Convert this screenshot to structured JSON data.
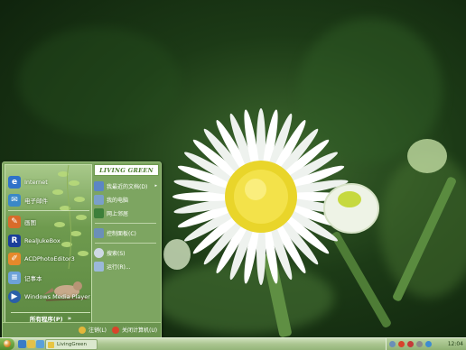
{
  "theme": {
    "accent": "#6b9550",
    "brand_color": "#4a7c2c",
    "panel": "#7da561"
  },
  "start_menu": {
    "brand": "LIVING GREEN",
    "pinned": [
      {
        "label": "Internet",
        "icon": "globe-icon",
        "color": "#2f72c9"
      },
      {
        "label": "电子邮件",
        "icon": "mail-icon",
        "color": "#3b88c7"
      }
    ],
    "recent": [
      {
        "label": "画图",
        "icon": "paint-icon",
        "color": "#d86b2a"
      },
      {
        "label": "RealJukeBox",
        "icon": "realplayer-icon",
        "color": "#1a3f9a"
      },
      {
        "label": "ACDPhotoEditor3",
        "icon": "photo-editor-icon",
        "color": "#e6892b"
      },
      {
        "label": "记事本",
        "icon": "notepad-icon",
        "color": "#6da2d8"
      },
      {
        "label": "Windows Media Player",
        "icon": "media-player-icon",
        "color": "#2a5fa8"
      }
    ],
    "all_programs": "所有程序(P)",
    "all_programs_arrow": "»",
    "right_items": [
      {
        "label": "我最近的文档(D)",
        "icon": "recent-docs-icon",
        "arrow": "▸",
        "color": "#5c86c4"
      },
      {
        "label": "我的电脑",
        "icon": "my-computer-icon",
        "color": "#7a9fc9"
      },
      {
        "label": "网上邻居",
        "icon": "network-icon",
        "color": "#3d7f3a"
      },
      {
        "label": "控制面板(C)",
        "icon": "control-panel-icon",
        "color": "#6b8fb8"
      },
      {
        "label": "搜索(S)",
        "icon": "search-icon",
        "color": "#cfd9e6"
      },
      {
        "label": "运行(R)...",
        "icon": "run-icon",
        "color": "#9bb8d9"
      }
    ],
    "logoff": "注销(L)",
    "shutdown": "关闭计算机(U)"
  },
  "taskbar": {
    "task_label": "LivingGreen",
    "clock": "12:04"
  }
}
